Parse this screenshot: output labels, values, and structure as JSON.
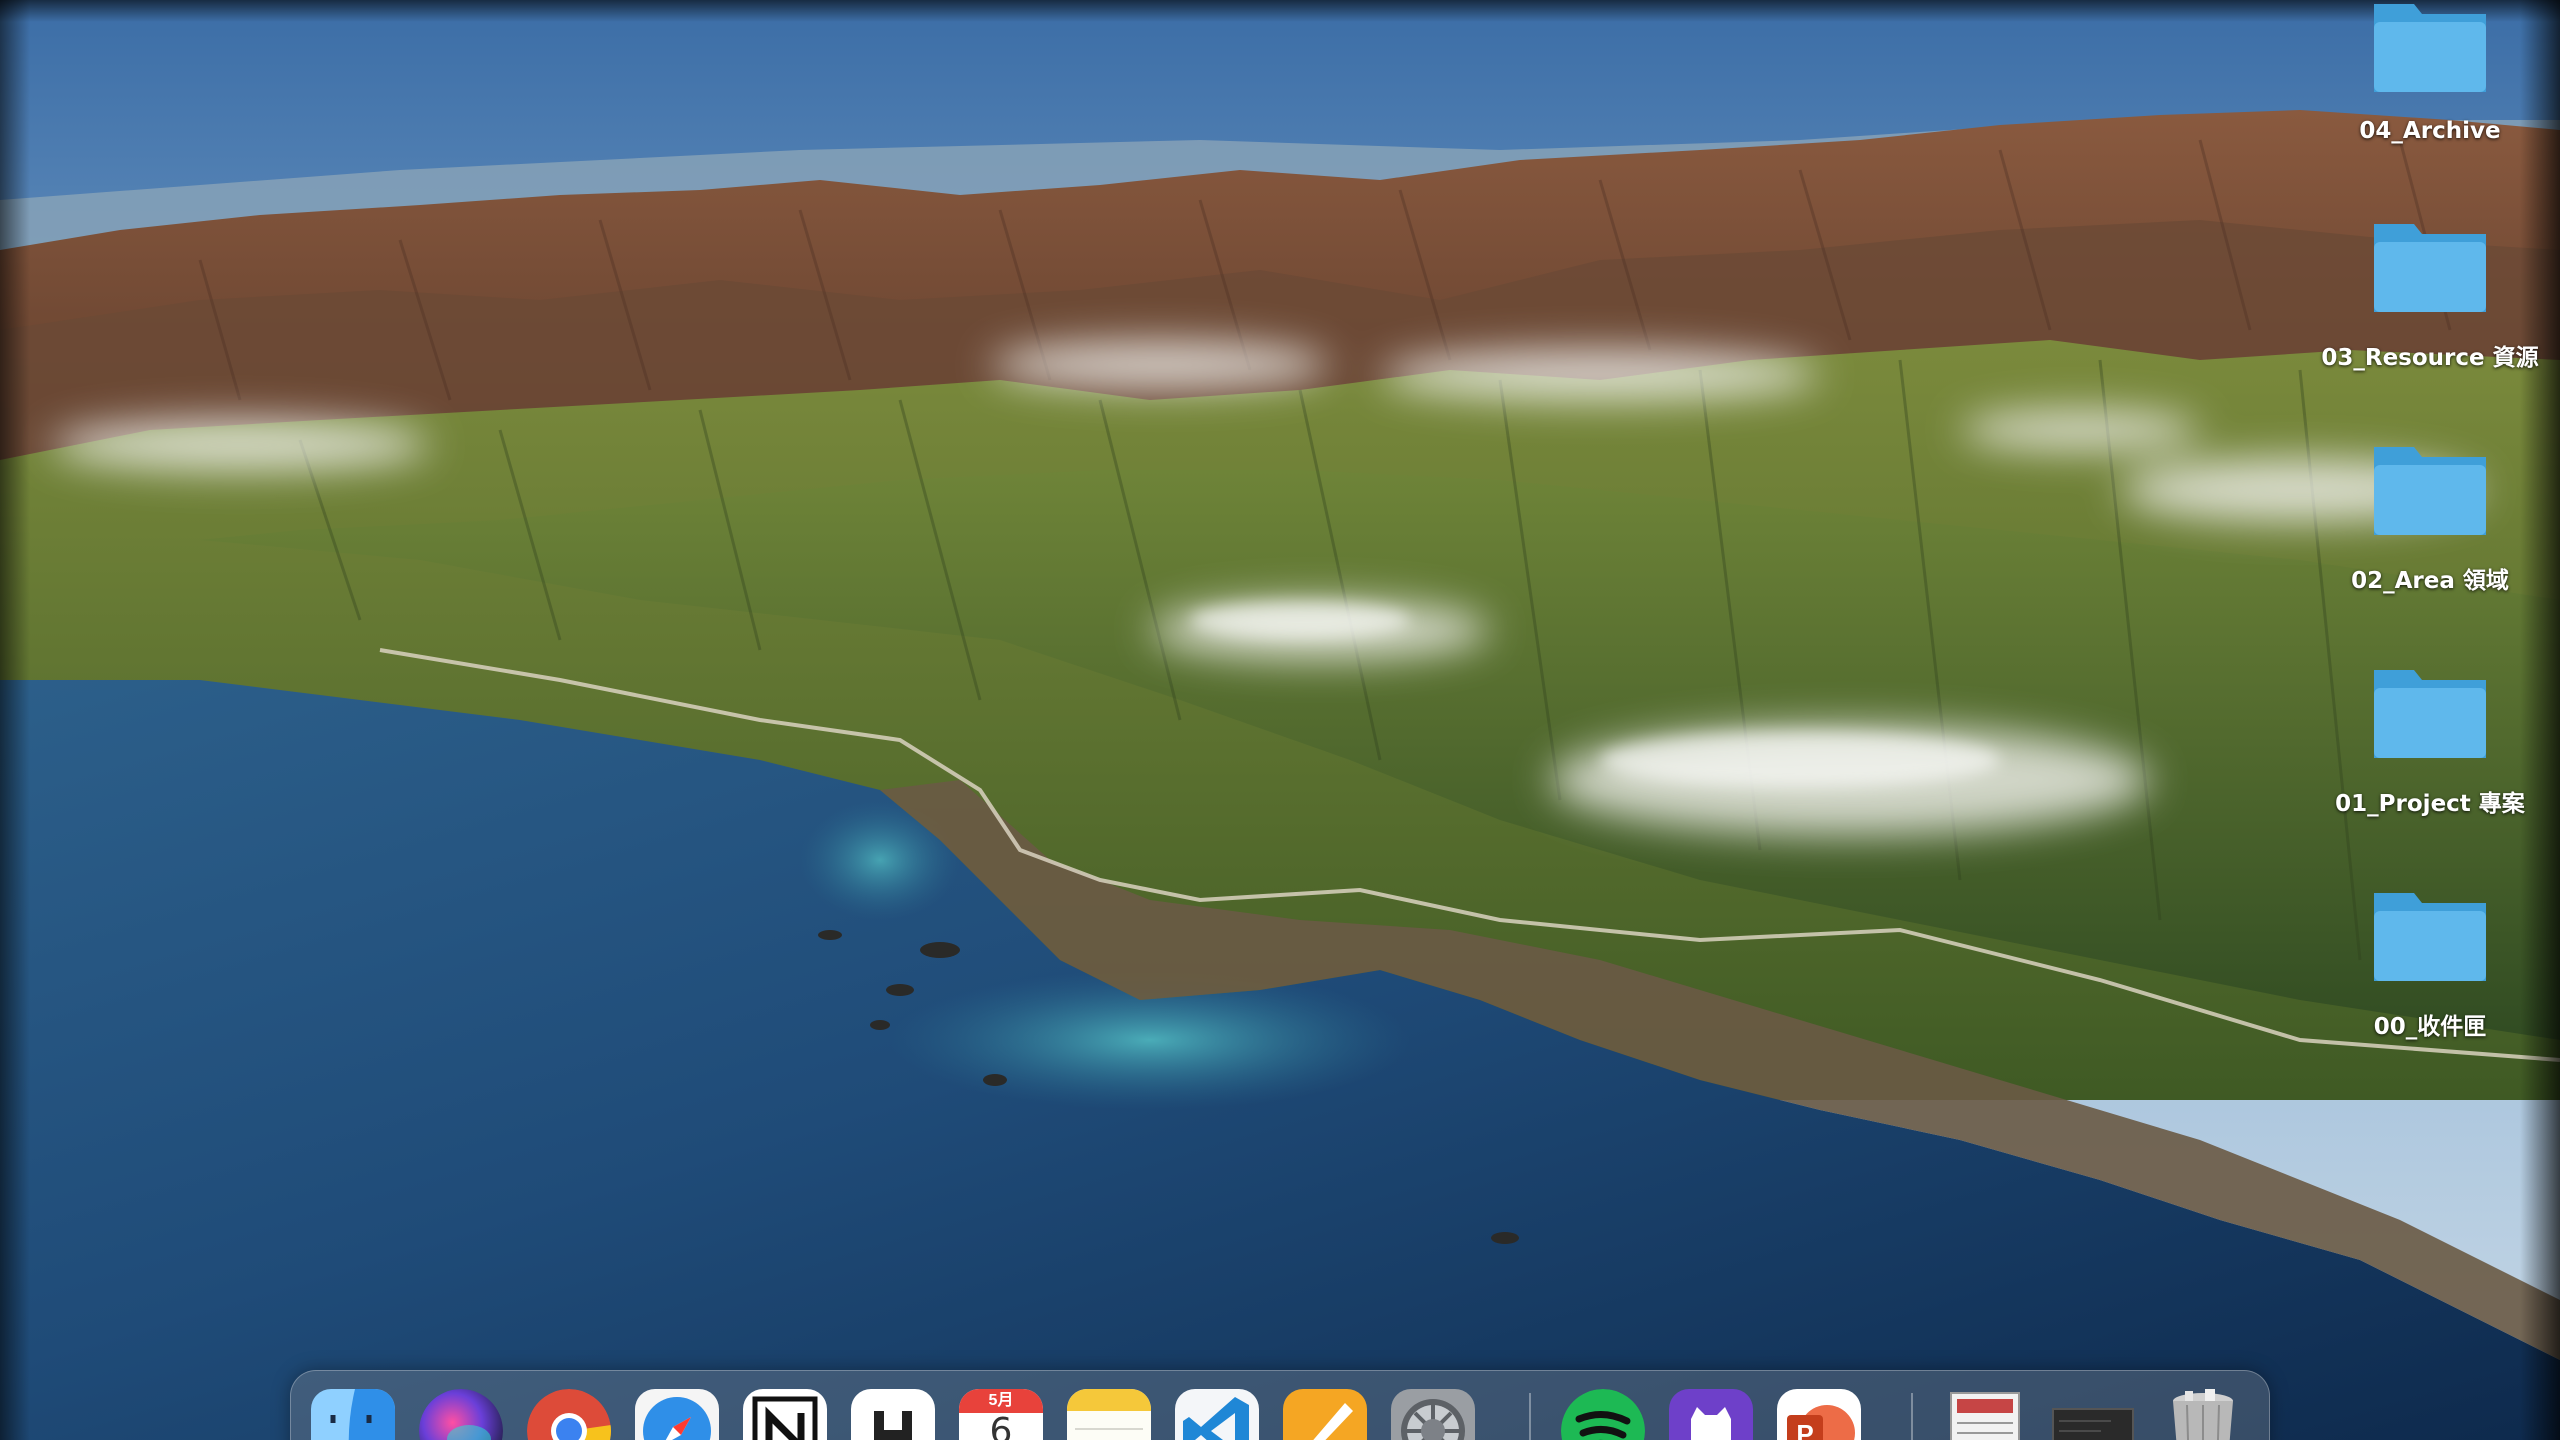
{
  "desktop": {
    "folders": [
      {
        "name": "04_Archive"
      },
      {
        "name": "03_Resource 資源"
      },
      {
        "name": "02_Area 領域"
      },
      {
        "name": "01_Project 專案"
      },
      {
        "name": "00_收件匣"
      }
    ]
  },
  "dock": {
    "apps": [
      {
        "name": "Finder",
        "icon": "finder-icon"
      },
      {
        "name": "Siri",
        "icon": "siri-icon"
      },
      {
        "name": "Google Chrome",
        "icon": "chrome-icon"
      },
      {
        "name": "Safari",
        "icon": "safari-icon"
      },
      {
        "name": "Notion",
        "icon": "notion-icon"
      },
      {
        "name": "HackMD",
        "icon": "hackmd-icon"
      },
      {
        "name": "Calendar",
        "icon": "calendar-icon",
        "month": "5月",
        "day": "6"
      },
      {
        "name": "Notes",
        "icon": "notes-icon"
      },
      {
        "name": "Visual Studio Code",
        "icon": "vscode-icon"
      },
      {
        "name": "Pages",
        "icon": "pages-icon"
      },
      {
        "name": "System Preferences",
        "icon": "system-preferences-icon"
      },
      {
        "name": "Spotify",
        "icon": "spotify-icon"
      },
      {
        "name": "GitHub Desktop",
        "icon": "github-desktop-icon"
      },
      {
        "name": "Microsoft PowerPoint",
        "icon": "powerpoint-icon"
      },
      {
        "name": "Document",
        "icon": "document-icon"
      },
      {
        "name": "Terminal Window",
        "icon": "window-thumbnail-icon"
      },
      {
        "name": "Trash",
        "icon": "trash-icon"
      }
    ]
  },
  "colors": {
    "folder": "#5fb8ec",
    "folder_dark": "#3f9fd9",
    "calendar_red": "#e8423b",
    "spotify_green": "#1db954"
  }
}
